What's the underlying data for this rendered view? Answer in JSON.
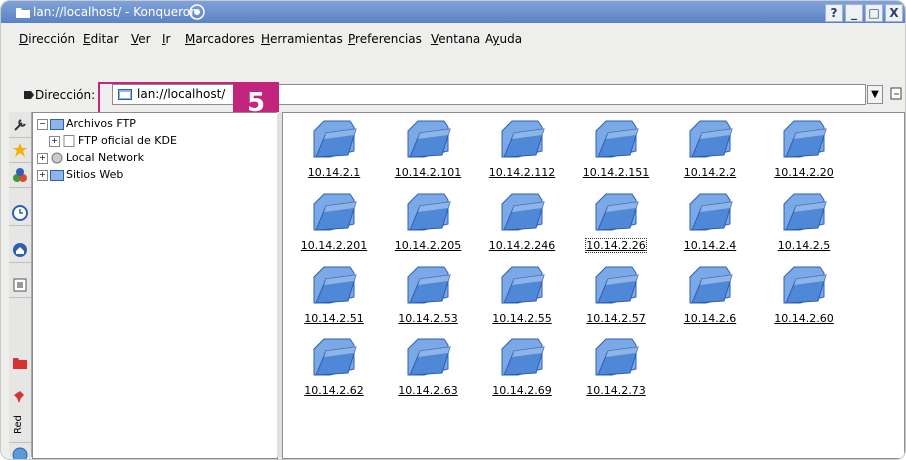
{
  "window": {
    "title": "lan://localhost/ - Konqueror",
    "buttons": [
      "?",
      "_",
      "□",
      "X"
    ]
  },
  "menu": [
    "Dirección",
    "Editar",
    "Ver",
    "Ir",
    "Marcadores",
    "Herramientas",
    "Preferencias",
    "Ventana",
    "Ayuda"
  ],
  "menu_underline": [
    "D",
    "E",
    "V",
    "I",
    "M",
    "H",
    "P",
    "V",
    "y"
  ],
  "address": {
    "label": "Dirección:",
    "value": "lan://localhost/"
  },
  "callout_number": "5",
  "sidebar": {
    "red_tab": "Red"
  },
  "tree": {
    "items": [
      {
        "label": "Archivos FTP",
        "level": 0
      },
      {
        "label": "FTP oficial de KDE",
        "level": 1
      },
      {
        "label": "Local Network",
        "level": 0
      },
      {
        "label": "Sitios Web",
        "level": 0
      }
    ]
  },
  "folders": [
    "10.14.2.1",
    "10.14.2.101",
    "10.14.2.112",
    "10.14.2.151",
    "10.14.2.2",
    "10.14.2.20",
    "10.14.2.201",
    "10.14.2.205",
    "10.14.2.246",
    "10.14.2.26",
    "10.14.2.4",
    "10.14.2.5",
    "10.14.2.51",
    "10.14.2.53",
    "10.14.2.55",
    "10.14.2.57",
    "10.14.2.6",
    "10.14.2.60",
    "10.14.2.62",
    "10.14.2.63",
    "10.14.2.69",
    "10.14.2.73"
  ],
  "focused_folder": "10.14.2.26",
  "colors": {
    "titlebar": "#5b82c4",
    "callout": "#c2257c",
    "folder": "#4f88d6"
  }
}
